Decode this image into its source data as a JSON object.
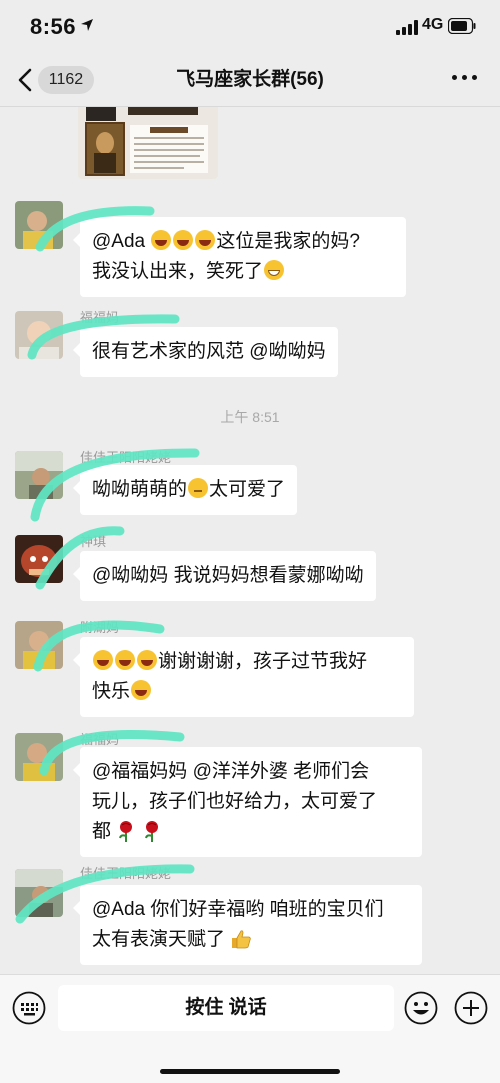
{
  "status_bar": {
    "time": "8:56",
    "network": "4G",
    "icons": [
      "location-icon",
      "signal-icon",
      "battery-icon"
    ]
  },
  "nav": {
    "back_badge": "1162",
    "title": "飞马座家长群(56)",
    "icons": [
      "back-icon",
      "more-icon"
    ]
  },
  "messages": {
    "m1": {
      "pre": "@Ada ",
      "mid": "这位是我家的妈?",
      "line2": "我没认出来，笑死了"
    },
    "m2": {
      "name": "福福妈",
      "text": "很有艺术家的风范 @呦呦妈"
    },
    "timestamp": "上午 8:51",
    "m3": {
      "name": "佳佳王阳阳姥姥",
      "text": "呦呦萌萌的",
      "text2": "太可爱了"
    },
    "m4": {
      "name": "神琪",
      "text": "@呦呦妈 我说妈妈想看蒙娜呦呦"
    },
    "m5": {
      "name": "附湖妈",
      "text": "谢谢谢谢，孩子过节我好",
      "line2": "快乐"
    },
    "m6": {
      "name": "福福妈",
      "line1": "@福福妈妈 @洋洋外婆 老师们会",
      "line2": "玩儿，孩子们也好给力，太可爱了",
      "line3": "都"
    },
    "m7": {
      "name": "佳佳王阳阳姥姥",
      "line1": "@Ada 你们好幸福哟 咱班的宝贝们",
      "line2": "太有表演天赋了"
    }
  },
  "input_bar": {
    "hold_to_talk": "按住 说话",
    "icons": [
      "keyboard-icon",
      "emoji-icon",
      "plus-icon"
    ]
  },
  "colors": {
    "background": "#ededed",
    "bubble": "#ffffff",
    "scribble": "#5fe6c3"
  }
}
